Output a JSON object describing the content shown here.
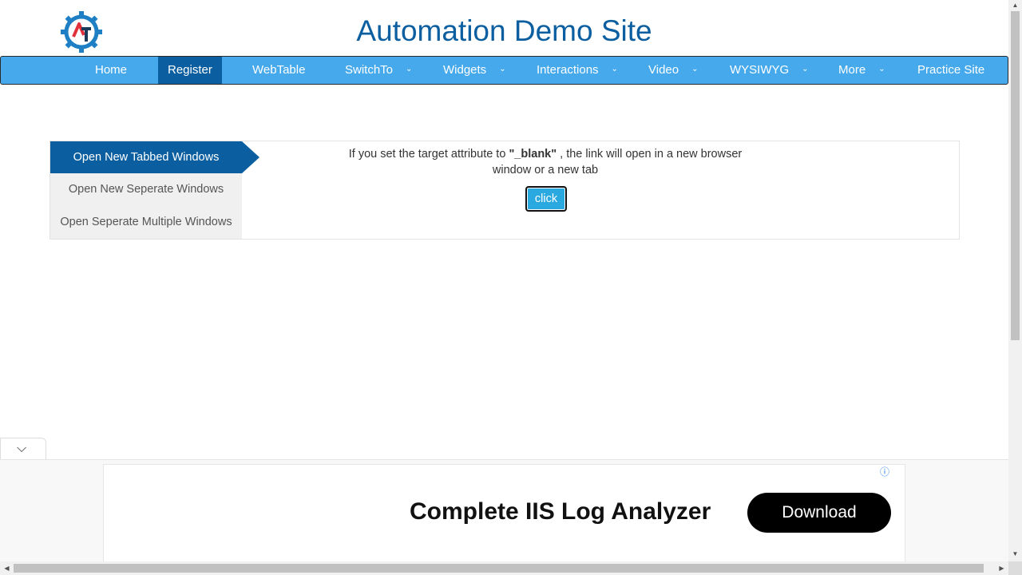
{
  "header": {
    "title": "Automation Demo Site",
    "logo_icon": "gear-at-logo-icon"
  },
  "nav": {
    "items": [
      {
        "label": "Home",
        "dropdown": false
      },
      {
        "label": "Register",
        "dropdown": false,
        "active": true
      },
      {
        "label": "WebTable",
        "dropdown": false
      },
      {
        "label": "SwitchTo",
        "dropdown": true
      },
      {
        "label": "Widgets",
        "dropdown": true
      },
      {
        "label": "Interactions",
        "dropdown": true
      },
      {
        "label": "Video",
        "dropdown": true
      },
      {
        "label": "WYSIWYG",
        "dropdown": true
      },
      {
        "label": "More",
        "dropdown": true
      },
      {
        "label": "Practice Site",
        "dropdown": false
      }
    ],
    "chevron_glyph": "⌄",
    "bar_color": "#45a9ec",
    "active_color": "#0b5fa0"
  },
  "tabs": {
    "items": [
      {
        "label": "Open New Tabbed Windows",
        "active": true
      },
      {
        "label": "Open New Seperate Windows"
      },
      {
        "label": "Open Seperate Multiple Windows"
      }
    ]
  },
  "content": {
    "text_before": "If you set the target attribute to ",
    "text_bold": "\"_blank\"",
    "text_after": " , the link will open in a new browser window or a new tab",
    "button_label": "click"
  },
  "ad": {
    "headline": "Complete IIS Log Analyzer",
    "button_label": "Download",
    "info_glyph": "ⓘ",
    "collapse_glyph": "⌵"
  },
  "scrollbars": {
    "up_glyph": "▲",
    "down_glyph": "▼",
    "left_glyph": "◀",
    "right_glyph": "▶"
  }
}
